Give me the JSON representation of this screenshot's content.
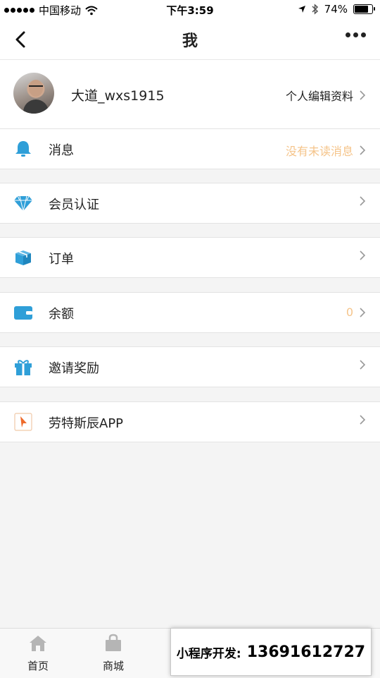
{
  "status_bar": {
    "carrier": "中国移动",
    "time": "下午3:59",
    "battery_percent": "74%",
    "battery_level": 0.74,
    "icons": [
      "signal-dots-icon",
      "wifi-icon",
      "location-icon",
      "bluetooth-icon",
      "battery-icon"
    ]
  },
  "nav": {
    "title": "我",
    "back_icon": "chevron-left-icon",
    "more_icon": "more-dots-icon"
  },
  "profile": {
    "username": "大道_wxs1915",
    "edit_label": "个人编辑资料"
  },
  "menu": [
    {
      "id": "messages",
      "label": "消息",
      "hint": "没有未读消息",
      "icon": "bell-icon"
    },
    {
      "id": "membership",
      "label": "会员认证",
      "hint": "",
      "icon": "diamond-icon"
    },
    {
      "id": "orders",
      "label": "订单",
      "hint": "",
      "icon": "box-icon"
    },
    {
      "id": "balance",
      "label": "余额",
      "hint": "0",
      "icon": "wallet-icon"
    },
    {
      "id": "invite",
      "label": "邀请奖励",
      "hint": "",
      "icon": "gift-icon"
    },
    {
      "id": "app",
      "label": "劳特斯辰APP",
      "hint": "",
      "icon": "app-logo-icon"
    }
  ],
  "tabs": [
    {
      "label": "首页",
      "icon": "home-icon"
    },
    {
      "label": "商城",
      "icon": "bag-icon"
    }
  ],
  "promo": {
    "label": "小程序开发:",
    "phone": "13691612727"
  },
  "colors": {
    "accent_blue": "#2f9fd8",
    "hint_orange": "#f5c48a",
    "app_orange": "#ee6a2a",
    "background": "#f4f4f4"
  }
}
